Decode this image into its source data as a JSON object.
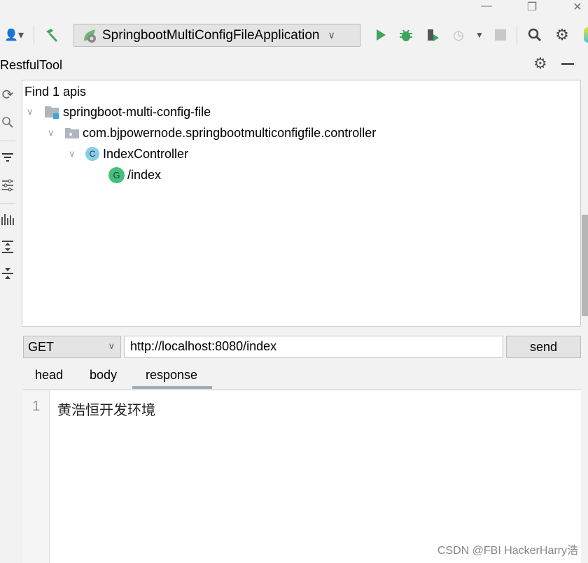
{
  "window": {
    "minimize_icon": "minimize-icon",
    "restore_icon": "restore-icon",
    "close_icon": "close-icon"
  },
  "toolbar": {
    "run_config": "SpringbootMultiConfigFileApplication"
  },
  "panel": {
    "title": "RestfulTool"
  },
  "tree": {
    "summary": "Find 1 apis",
    "project": "springboot-multi-config-file",
    "package": "com.bjpowernode.springbootmulticonfigfile.controller",
    "controller": "IndexController",
    "controller_badge": "C",
    "endpoint_badge": "G",
    "endpoint": "/index"
  },
  "request": {
    "method": "GET",
    "url": "http://localhost:8080/index",
    "send_label": "send"
  },
  "tabs": [
    {
      "label": "head"
    },
    {
      "label": "body"
    },
    {
      "label": "response",
      "active": true
    }
  ],
  "response": {
    "line_number": "1",
    "text": "黄浩恒开发环境"
  },
  "watermark": "CSDN @FBI HackerHarry浩",
  "colors": {
    "accent_green": "#3ea55a",
    "method_badge": "#45c07a",
    "class_badge": "#88cde8",
    "tab_underline": "#a0aab8"
  }
}
